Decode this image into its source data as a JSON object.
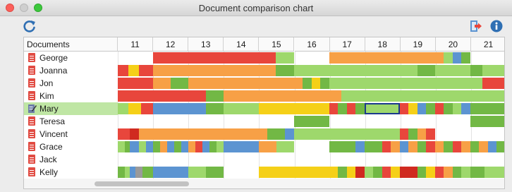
{
  "window": {
    "title": "Document comparison chart"
  },
  "toolbar": {
    "refresh_icon": "refresh-icon",
    "export_icon": "export-icon",
    "info_icon": "info-icon"
  },
  "table": {
    "documents_header": "Documents",
    "columns": [
      "11",
      "12",
      "13",
      "14",
      "15",
      "16",
      "17",
      "18",
      "19",
      "20",
      "21"
    ],
    "selected_row": "Mary",
    "rows": [
      {
        "name": "George",
        "icon": "document-icon"
      },
      {
        "name": "Joanna",
        "icon": "document-icon"
      },
      {
        "name": "Jon",
        "icon": "document-icon"
      },
      {
        "name": "Kim",
        "icon": "document-icon"
      },
      {
        "name": "Mary",
        "icon": "pencil-document-icon"
      },
      {
        "name": "Teresa",
        "icon": "document-icon"
      },
      {
        "name": "Vincent",
        "icon": "document-icon"
      },
      {
        "name": "Grace",
        "icon": "document-icon"
      },
      {
        "name": "Jack",
        "icon": "document-icon"
      },
      {
        "name": "Kelly",
        "icon": "document-icon"
      }
    ]
  },
  "colors": {
    "red": "#e8463c",
    "orange": "#f7a046",
    "light_green": "#9ed86c",
    "green": "#72b845",
    "blue": "#5c94d1",
    "yellow": "#f5d018",
    "dark_red": "#d02a20",
    "gray": "#9a9a9a",
    "selected_row": "#bfe6a4"
  }
}
